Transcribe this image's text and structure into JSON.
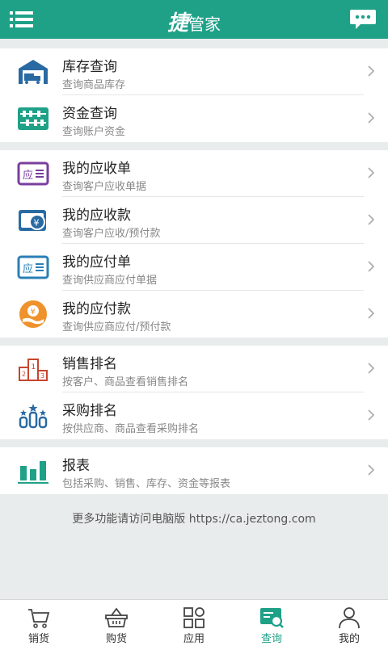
{
  "header": {
    "logo_main": "捷",
    "logo_sub": "管家",
    "menu_icon": "menu-icon",
    "chat_icon": "chat-icon",
    "color": "#1fa188"
  },
  "groups": [
    {
      "items": [
        {
          "title": "库存查询",
          "sub": "查询商品库存",
          "icon": "warehouse-icon"
        },
        {
          "title": "资金查询",
          "sub": "查询账户资金",
          "icon": "abacus-icon"
        }
      ]
    },
    {
      "items": [
        {
          "title": "我的应收单",
          "sub": "查询客户应收单据",
          "icon": "receivable-bill-icon"
        },
        {
          "title": "我的应收款",
          "sub": "查询客户应收/预付款",
          "icon": "receivable-money-icon"
        },
        {
          "title": "我的应付单",
          "sub": "查询供应商应付单据",
          "icon": "payable-bill-icon"
        },
        {
          "title": "我的应付款",
          "sub": "查询供应商应付/预付款",
          "icon": "payable-money-icon"
        }
      ]
    },
    {
      "items": [
        {
          "title": "销售排名",
          "sub": "按客户、商品查看销售排名",
          "icon": "podium-icon"
        },
        {
          "title": "采购排名",
          "sub": "按供应商、商品查看采购排名",
          "icon": "ranking-icon"
        }
      ]
    },
    {
      "items": [
        {
          "title": "报表",
          "sub": "包括采购、销售、库存、资金等报表",
          "icon": "bar-chart-icon"
        }
      ]
    }
  ],
  "footer_note": "更多功能请访问电脑版 https://ca.jeztong.com",
  "tabs": [
    {
      "label": "销货",
      "icon": "cart-icon",
      "active": false
    },
    {
      "label": "购货",
      "icon": "basket-icon",
      "active": false
    },
    {
      "label": "应用",
      "icon": "apps-icon",
      "active": false
    },
    {
      "label": "查询",
      "icon": "query-icon",
      "active": true
    },
    {
      "label": "我的",
      "icon": "user-icon",
      "active": false
    }
  ]
}
